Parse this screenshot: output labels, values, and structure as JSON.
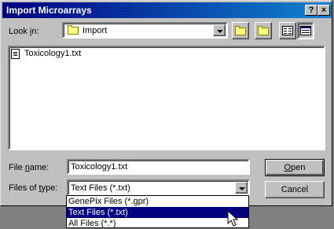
{
  "window": {
    "title": "Import Microarrays",
    "help_label": "?",
    "close_label": "×"
  },
  "lookin": {
    "label": "Look in:",
    "value": "Import",
    "icon": "folder-icon"
  },
  "toolbar": {
    "up_icon": "up-folder-icon",
    "new_icon": "new-folder-icon",
    "list_icon": "list-view-icon",
    "details_icon": "details-view-icon"
  },
  "files": [
    {
      "name": "Toxicology1.txt",
      "icon": "text-file-icon"
    }
  ],
  "filename": {
    "label": "File name:",
    "value": "Toxicology1.txt"
  },
  "filetype": {
    "label": "Files of type:",
    "value": "Text Files (*.txt)",
    "options": [
      "GenePix Files (*.gpr)",
      "Text Files (*.txt)",
      "All Files (*.*)"
    ],
    "selected_index": 1
  },
  "buttons": {
    "open": "Open",
    "cancel": "Cancel"
  }
}
